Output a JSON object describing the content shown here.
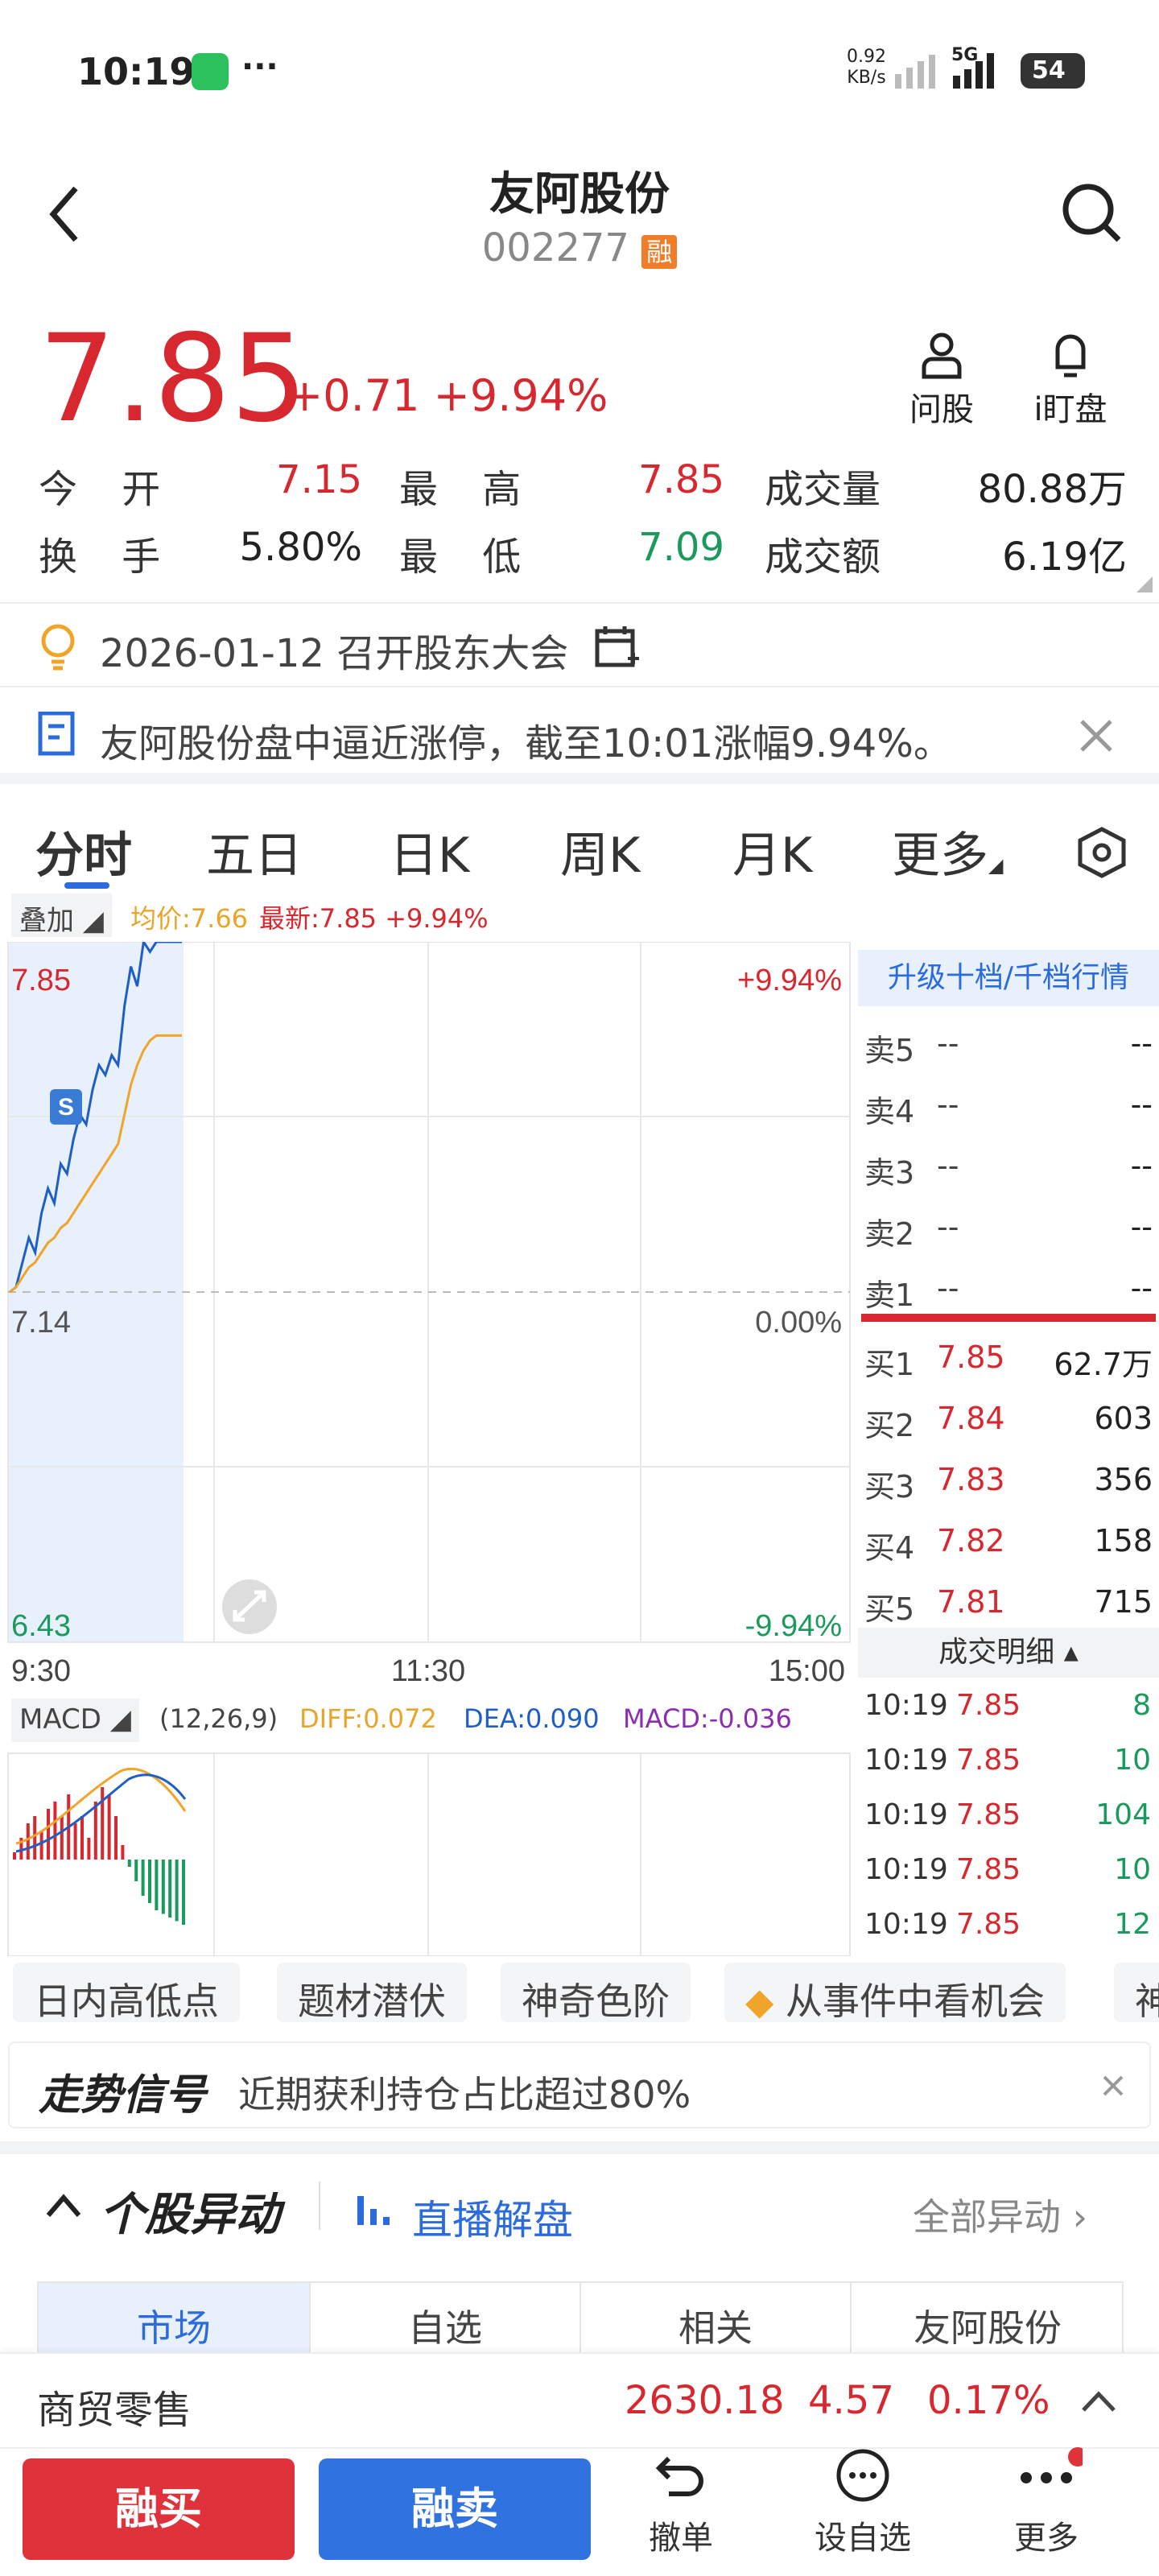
{
  "status": {
    "time": "10:19",
    "net_speed": "0.92",
    "net_unit": "KB/s",
    "battery": "54",
    "signal": "5G"
  },
  "header": {
    "name": "友阿股份",
    "code": "002277",
    "badge": "融"
  },
  "quote": {
    "price": "7.85",
    "change": "+0.71",
    "pct": "+9.94%",
    "actions": [
      {
        "label": "问股"
      },
      {
        "label": "i盯盘"
      }
    ],
    "rows": [
      [
        {
          "k": "今 开",
          "v": "7.15",
          "c": "red"
        },
        {
          "k": "最 高",
          "v": "7.85",
          "c": "red"
        },
        {
          "k": "成交量",
          "v": "80.88万",
          "c": "dark"
        }
      ],
      [
        {
          "k": "换 手",
          "v": "5.80%",
          "c": "dark"
        },
        {
          "k": "最 低",
          "v": "7.09",
          "c": "green"
        },
        {
          "k": "成交额",
          "v": "6.19亿",
          "c": "dark"
        }
      ]
    ]
  },
  "event": {
    "text": "2026-01-12 召开股东大会"
  },
  "news": {
    "text": "友阿股份盘中逼近涨停，截至10:01涨幅9.94%。"
  },
  "tabs": [
    "分时",
    "五日",
    "日K",
    "周K",
    "月K",
    "更多"
  ],
  "chart_legend": {
    "overlay": "叠加",
    "avg": "均价:7.66",
    "last": "最新:7.85 +9.94%"
  },
  "chart_data": {
    "type": "line",
    "price_axis": {
      "top": "7.85",
      "mid": "7.14",
      "bottom": "6.43"
    },
    "pct_axis": {
      "top": "+9.94%",
      "mid": "0.00%",
      "bottom": "-9.94%"
    },
    "time_axis": [
      "9:30",
      "11:30",
      "15:00"
    ],
    "ylim": [
      6.43,
      7.85
    ],
    "series": [
      {
        "name": "最新",
        "color": "#1f5fc4",
        "values": [
          7.14,
          7.15,
          7.2,
          7.25,
          7.22,
          7.3,
          7.35,
          7.32,
          7.4,
          7.38,
          7.45,
          7.5,
          7.48,
          7.55,
          7.6,
          7.58,
          7.62,
          7.6,
          7.72,
          7.8,
          7.76,
          7.85,
          7.83,
          7.85,
          7.85,
          7.85,
          7.85,
          7.85
        ]
      },
      {
        "name": "均价",
        "color": "#f0a52a",
        "values": [
          7.14,
          7.15,
          7.17,
          7.19,
          7.2,
          7.22,
          7.24,
          7.25,
          7.27,
          7.28,
          7.3,
          7.32,
          7.34,
          7.36,
          7.38,
          7.4,
          7.42,
          7.44,
          7.5,
          7.56,
          7.6,
          7.63,
          7.65,
          7.66,
          7.66,
          7.66,
          7.66,
          7.66
        ]
      }
    ],
    "marker": "S",
    "macd": {
      "label": "MACD",
      "params": "(12,26,9)",
      "diff": "DIFF:0.072",
      "dea": "DEA:0.090",
      "macd": "MACD:-0.036",
      "bars": [
        0.1,
        0.3,
        0.5,
        0.6,
        0.4,
        0.7,
        0.8,
        0.6,
        0.9,
        0.5,
        0.6,
        0.3,
        0.8,
        1.0,
        0.9,
        0.6,
        0.2,
        -0.1,
        -0.3,
        -0.5,
        -0.6,
        -0.7,
        -0.75,
        -0.8,
        -0.85,
        -0.9
      ]
    }
  },
  "orderbook": {
    "upgrade": "升级十档/千档行情",
    "asks": [
      {
        "k": "卖5",
        "p": "--",
        "v": "--"
      },
      {
        "k": "卖4",
        "p": "--",
        "v": "--"
      },
      {
        "k": "卖3",
        "p": "--",
        "v": "--"
      },
      {
        "k": "卖2",
        "p": "--",
        "v": "--"
      },
      {
        "k": "卖1",
        "p": "--",
        "v": "--"
      }
    ],
    "bids": [
      {
        "k": "买1",
        "p": "7.85",
        "v": "62.7万"
      },
      {
        "k": "买2",
        "p": "7.84",
        "v": "603"
      },
      {
        "k": "买3",
        "p": "7.83",
        "v": "356"
      },
      {
        "k": "买4",
        "p": "7.82",
        "v": "158"
      },
      {
        "k": "买5",
        "p": "7.81",
        "v": "715"
      }
    ],
    "trades_title": "成交明细",
    "trades": [
      {
        "t": "10:19",
        "p": "7.85",
        "v": "8"
      },
      {
        "t": "10:19",
        "p": "7.85",
        "v": "10"
      },
      {
        "t": "10:19",
        "p": "7.85",
        "v": "104"
      },
      {
        "t": "10:19",
        "p": "7.85",
        "v": "10"
      },
      {
        "t": "10:19",
        "p": "7.85",
        "v": "12"
      }
    ]
  },
  "pills": [
    "日内高低点",
    "题材潜伏",
    "神奇色阶",
    "从事件中看机会",
    "神"
  ],
  "signal": {
    "title": "走势信号",
    "text": "近期获利持仓占比超过80%"
  },
  "movement": {
    "title": "个股异动",
    "live": "直播解盘",
    "all": "全部异动"
  },
  "sub_tabs": [
    "市场",
    "自选",
    "相关",
    "友阿股份"
  ],
  "sector": {
    "name": "商贸零售",
    "index": "2630.18",
    "chg": "4.57",
    "pct": "0.17%"
  },
  "bottom": {
    "buy": "融买",
    "sell": "融卖",
    "cancel": "撤单",
    "watch": "设自选",
    "more": "更多"
  }
}
